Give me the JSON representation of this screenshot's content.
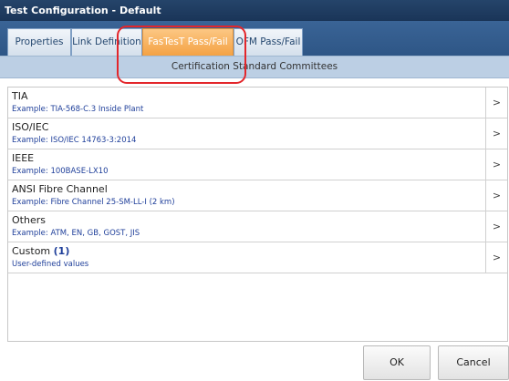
{
  "window": {
    "title": "Test Configuration - Default"
  },
  "tabs": [
    {
      "label": "Properties"
    },
    {
      "label": "Link Definition"
    },
    {
      "label": "FasTesT Pass/Fail"
    },
    {
      "label": "OFM Pass/Fail"
    }
  ],
  "section": {
    "header": "Certification Standard Committees"
  },
  "items": [
    {
      "title": "TIA",
      "subtitle": "Example: TIA-568-C.3 Inside Plant",
      "chevron": ">"
    },
    {
      "title": "ISO/IEC",
      "subtitle": "Example: ISO/IEC 14763-3:2014",
      "chevron": ">"
    },
    {
      "title": "IEEE",
      "subtitle": "Example: 100BASE-LX10",
      "chevron": ">"
    },
    {
      "title": "ANSI Fibre Channel",
      "subtitle": "Example: Fibre Channel 25-SM-LL-I (2 km)",
      "chevron": ">"
    },
    {
      "title": "Others",
      "subtitle": "Example: ATM, EN, GB, GOST, JIS",
      "chevron": ">"
    },
    {
      "title": "Custom",
      "count": "(1)",
      "subtitle": "User-defined values",
      "chevron": ">"
    }
  ],
  "buttons": {
    "ok": "OK",
    "cancel": "Cancel"
  },
  "colors": {
    "highlight": "#e3262b",
    "active_tab": "#f4a244",
    "link_text": "#1f3f9a"
  }
}
